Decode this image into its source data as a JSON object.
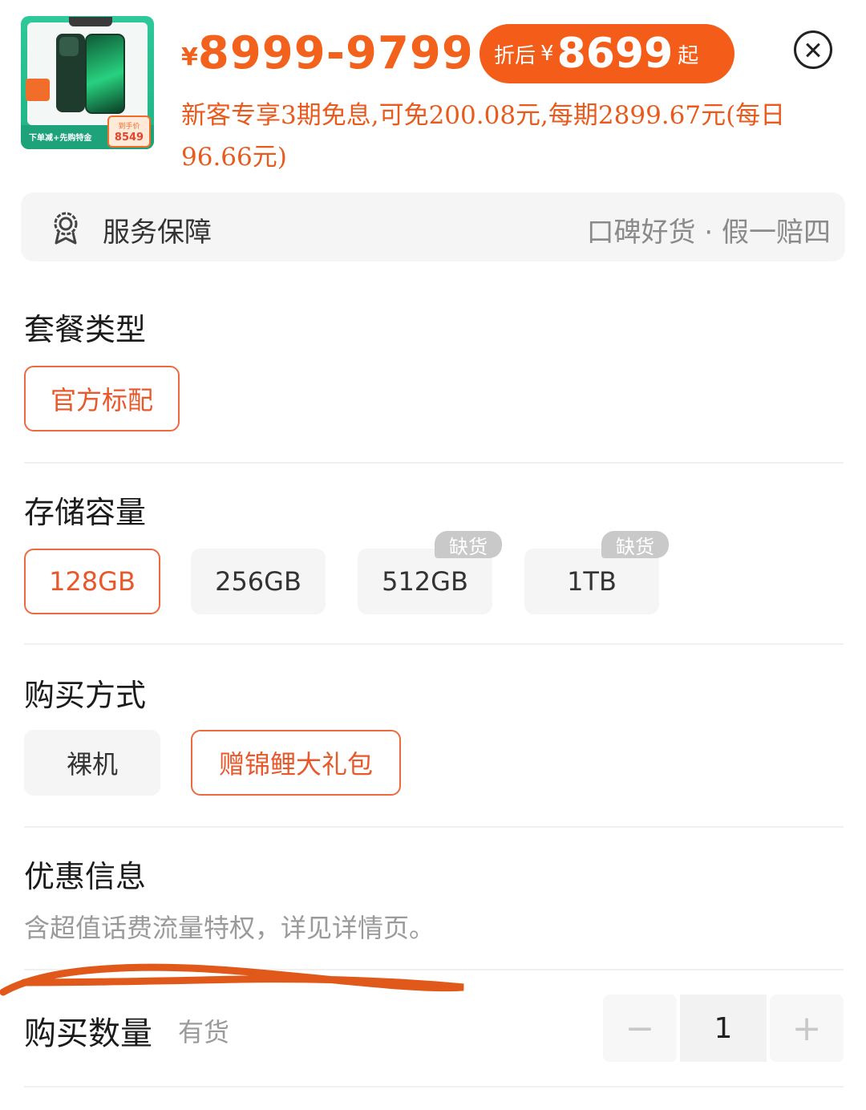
{
  "header": {
    "thumbnail": {
      "tag_text": "",
      "footer_text": "下单减+先购特金",
      "price_label": "到手价",
      "price_value": "8549"
    },
    "price_range_currency": "¥",
    "price_range": "8999-9799",
    "promo": {
      "label": "折后",
      "currency": "¥",
      "value": "8699",
      "suffix": "起"
    },
    "installment_text": "新客专享3期免息,可免200.08元,每期2899.67元(每日96.66元)"
  },
  "service": {
    "icon": "badge-icon",
    "label": "服务保障",
    "desc": "口碑好货 · 假一赔四"
  },
  "sections": {
    "package": {
      "title": "套餐类型",
      "options": [
        {
          "label": "官方标配",
          "selected": true
        }
      ]
    },
    "storage": {
      "title": "存储容量",
      "options": [
        {
          "label": "128GB",
          "selected": true,
          "soldout": ""
        },
        {
          "label": "256GB",
          "selected": false,
          "soldout": ""
        },
        {
          "label": "512GB",
          "selected": false,
          "soldout": "缺货"
        },
        {
          "label": "1TB",
          "selected": false,
          "soldout": "缺货"
        }
      ]
    },
    "purchase": {
      "title": "购买方式",
      "options": [
        {
          "label": "裸机",
          "selected": false
        },
        {
          "label": "赠锦鲤大礼包",
          "selected": true
        }
      ]
    },
    "promotion": {
      "title": "优惠信息",
      "text": "含超值话费流量特权，详见详情页。"
    }
  },
  "quantity": {
    "title": "购买数量",
    "stock": "有货",
    "minus": "−",
    "value": "1",
    "plus": "+"
  },
  "colors": {
    "accent": "#f45d19",
    "selected_border": "#ec6a3f",
    "chip_bg": "#f5f5f5",
    "soldout_bg": "#c9c9c9"
  }
}
